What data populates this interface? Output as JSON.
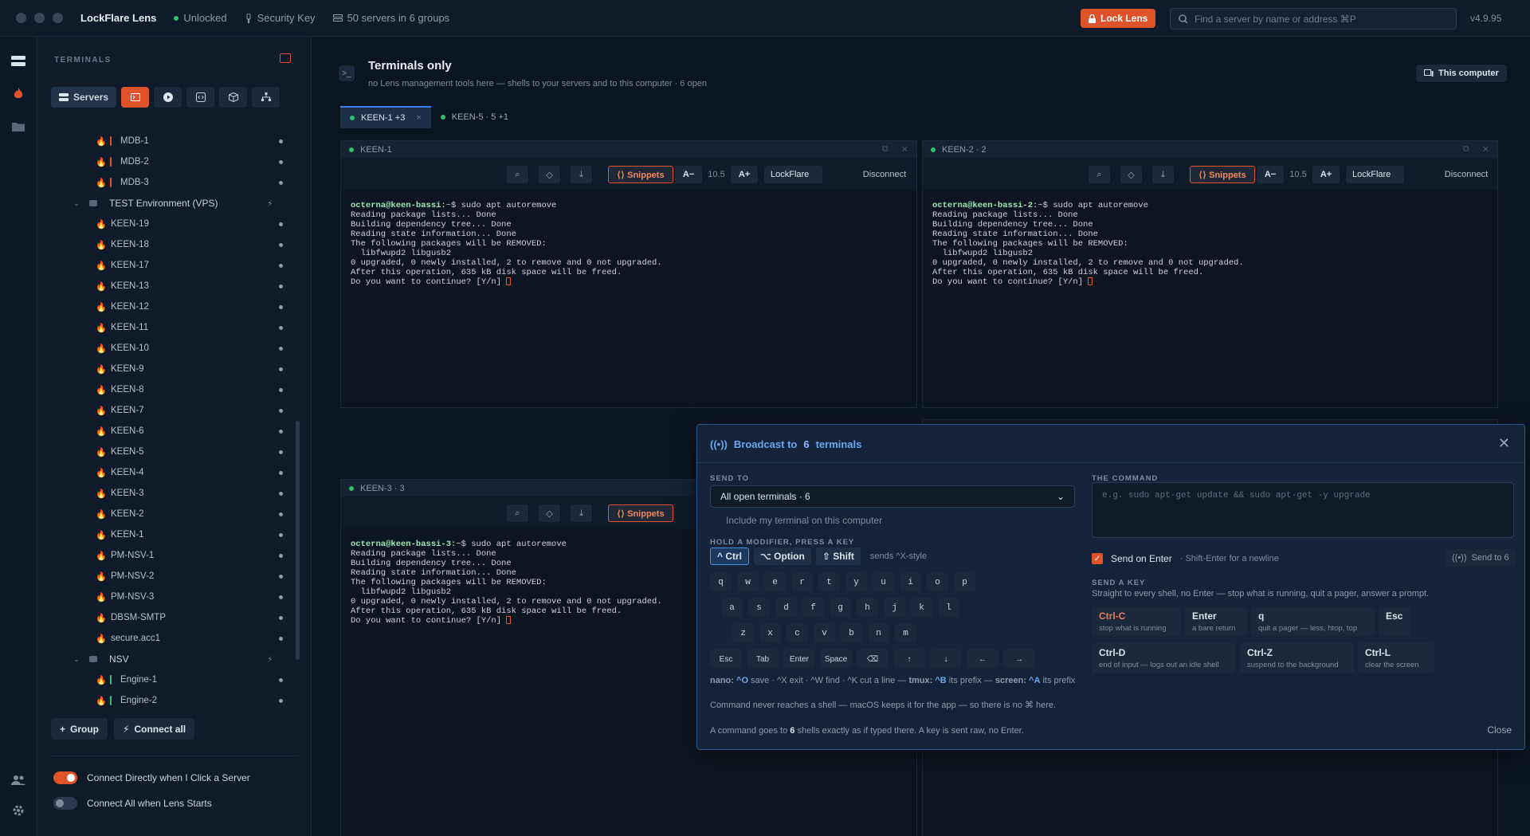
{
  "titlebar": {
    "app_name": "LockFlare Lens",
    "status": "Unlocked",
    "security_key": "Security Key",
    "servers_summary": "50 servers in 6 groups",
    "lock_button": "Lock Lens",
    "search_placeholder": "Find a server by name or address  ⌘P",
    "version": "v4.9.95"
  },
  "sidebar": {
    "heading": "TERMINALS",
    "servers_button": "Servers",
    "rows": [
      {
        "type": "server",
        "label": "MDB-1",
        "bar": "#e0532a"
      },
      {
        "type": "server",
        "label": "MDB-2",
        "bar": "#e0532a"
      },
      {
        "type": "server",
        "label": "MDB-3",
        "bar": "#e0532a"
      },
      {
        "type": "group",
        "label": "TEST Environment (VPS)"
      },
      {
        "type": "server",
        "label": "KEEN-19"
      },
      {
        "type": "server",
        "label": "KEEN-18"
      },
      {
        "type": "server",
        "label": "KEEN-17"
      },
      {
        "type": "server",
        "label": "KEEN-13"
      },
      {
        "type": "server",
        "label": "KEEN-12"
      },
      {
        "type": "server",
        "label": "KEEN-11"
      },
      {
        "type": "server",
        "label": "KEEN-10"
      },
      {
        "type": "server",
        "label": "KEEN-9"
      },
      {
        "type": "server",
        "label": "KEEN-8"
      },
      {
        "type": "server",
        "label": "KEEN-7"
      },
      {
        "type": "server",
        "label": "KEEN-6"
      },
      {
        "type": "server",
        "label": "KEEN-5"
      },
      {
        "type": "server",
        "label": "KEEN-4"
      },
      {
        "type": "server",
        "label": "KEEN-3"
      },
      {
        "type": "server",
        "label": "KEEN-2"
      },
      {
        "type": "server",
        "label": "KEEN-1"
      },
      {
        "type": "server",
        "label": "PM-NSV-1"
      },
      {
        "type": "server",
        "label": "PM-NSV-2"
      },
      {
        "type": "server",
        "label": "PM-NSV-3"
      },
      {
        "type": "server",
        "label": "DBSM-SMTP"
      },
      {
        "type": "server",
        "label": "secure.acc1"
      },
      {
        "type": "group",
        "label": "NSV"
      },
      {
        "type": "server",
        "label": "Engine-1",
        "bar": "#2fbf71"
      },
      {
        "type": "server",
        "label": "Engine-2",
        "bar": "#2fbf71"
      }
    ],
    "group_button": "Group",
    "connect_all_button": "Connect all",
    "toggle_connect_directly": "Connect Directly when I Click a Server",
    "toggle_connect_all": "Connect All when Lens Starts"
  },
  "main": {
    "title": "Terminals only",
    "subtitle": "no Lens management tools here — shells to your servers and to this computer · 6 open",
    "this_computer": "This computer",
    "tabs": [
      {
        "label": "KEEN-1 +3"
      },
      {
        "label": "KEEN-5 · 5 +1"
      }
    ]
  },
  "panes": [
    {
      "title": "KEEN-1",
      "prompt": "octerna@keen-bassi",
      "command": ":~$ sudo apt autoremove",
      "output": "Reading package lists... Done\nBuilding dependency tree... Done\nReading state information... Done\nThe following packages will be REMOVED:\n  libfwupd2 libgusb2\n0 upgraded, 0 newly installed, 2 to remove and 0 not upgraded.\nAfter this operation, 635 kB disk space will be freed.\nDo you want to continue? [Y/n] "
    },
    {
      "title": "KEEN-2 · 2",
      "prompt": "octerna@keen-bassi-2",
      "command": ":~$ sudo apt autoremove",
      "output": "Reading package lists... Done\nBuilding dependency tree... Done\nReading state information... Done\nThe following packages will be REMOVED:\n  libfwupd2 libgusb2\n0 upgraded, 0 newly installed, 2 to remove and 0 not upgraded.\nAfter this operation, 635 kB disk space will be freed.\nDo you want to continue? [Y/n] "
    },
    {
      "title": "KEEN-3 · 3",
      "prompt": "octerna@keen-bassi-3",
      "command": ":~$ sudo apt autoremove",
      "output": "Reading package lists... Done\nBuilding dependency tree... Done\nReading state information... Done\nThe following packages will be REMOVED:\n  libfwupd2 libgusb2\n0 upgraded, 0 newly installed, 2 to remove and 0 not upgraded.\nAfter this operation, 635 kB disk space will be freed.\nDo you want to continue? [Y/n] "
    }
  ],
  "pane_toolbar": {
    "snippets": "⟨⟩ Snippets",
    "font_down": "A−",
    "font_size": "10.5",
    "font_up": "A+",
    "theme": "LockFlare",
    "disconnect": "Disconnect"
  },
  "broadcast": {
    "title_prefix": "Broadcast to",
    "title_count": "6",
    "title_suffix": "terminals",
    "send_to_label": "SEND TO",
    "send_to_value": "All open terminals · 6",
    "include_label": "Include my terminal on this computer",
    "modifier_label": "HOLD A MODIFIER, PRESS A KEY",
    "modifiers": [
      "^ Ctrl",
      "⌥ Option",
      "⇧ Shift"
    ],
    "modifier_note": "sends ^X-style",
    "key_rows": [
      [
        "q",
        "w",
        "e",
        "r",
        "t",
        "y",
        "u",
        "i",
        "o",
        "p"
      ],
      [
        "a",
        "s",
        "d",
        "f",
        "g",
        "h",
        "j",
        "k",
        "l"
      ],
      [
        "z",
        "x",
        "c",
        "v",
        "b",
        "n",
        "m"
      ]
    ],
    "special_keys": [
      "Esc",
      "Tab",
      "Enter",
      "Space",
      "⌫",
      "↑",
      "↓",
      "←",
      "→"
    ],
    "help_nano": "nano:",
    "help_tmux": "tmux:",
    "help_screen": "screen:",
    "help_line1": " save · ^X exit · ^W find · ^K cut a line — ",
    "help_tmux_text": " its prefix — ",
    "help_screen_text": " its prefix",
    "help_keys": {
      "o": "^O",
      "b": "^B",
      "a": "^A"
    },
    "help_line2": "Command never reaches a shell — macOS keeps it for the app — so there is no ⌘ here.",
    "footer_prefix": "A command goes to",
    "footer_count": "6",
    "footer_suffix": "shells exactly as if typed there. A key is sent raw, no Enter.",
    "close_button": "Close",
    "command_label": "THE COMMAND",
    "command_placeholder": "e.g. sudo apt-get update && sudo apt-get -y upgrade",
    "send_on_enter": "Send on Enter",
    "send_on_enter_note": "· Shift-Enter for a newline",
    "send_to_button": "Send to 6",
    "send_key_label": "SEND A KEY",
    "send_key_desc": "Straight to every shell, no Enter — stop what is running, quit a pager, answer a prompt.",
    "send_keys": [
      {
        "key": "Ctrl-C",
        "desc": "stop what is running"
      },
      {
        "key": "Enter",
        "desc": "a bare return"
      },
      {
        "key": "q",
        "desc": "quit a pager — less, htop, top"
      },
      {
        "key": "Esc",
        "desc": ""
      },
      {
        "key": "Ctrl-D",
        "desc": "end of input — logs out an idle shell"
      },
      {
        "key": "Ctrl-Z",
        "desc": "suspend to the background"
      },
      {
        "key": "Ctrl-L",
        "desc": "clear the screen"
      }
    ]
  }
}
